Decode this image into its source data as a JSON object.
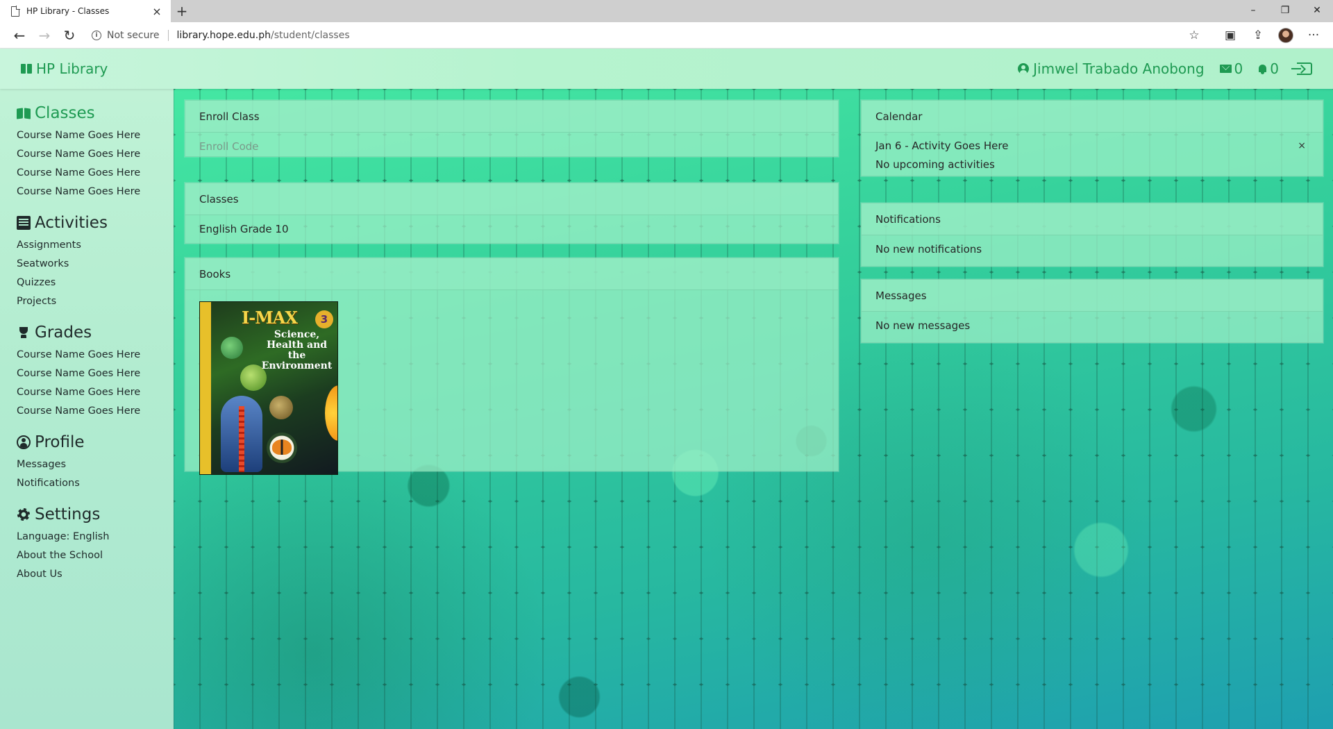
{
  "browser": {
    "tab_title": "HP Library - Classes",
    "tab_close": "×",
    "new_tab": "+",
    "security_label": "Not secure",
    "url_host": "library.hope.edu.ph",
    "url_path": "/student/classes",
    "window_controls": {
      "minimize": "–",
      "restore": "❐",
      "close": "✕"
    }
  },
  "navbar": {
    "brand": "HP Library",
    "user_name": "Jimwel Trabado Anobong",
    "message_count": "0",
    "notification_count": "0"
  },
  "sidebar": {
    "sections": [
      {
        "title": "Classes",
        "icon": "book-open-icon",
        "items": [
          "Course Name Goes Here",
          "Course Name Goes Here",
          "Course Name Goes Here",
          "Course Name Goes Here"
        ]
      },
      {
        "title": "Activities",
        "icon": "list-icon",
        "items": [
          "Assignments",
          "Seatworks",
          "Quizzes",
          "Projects"
        ]
      },
      {
        "title": "Grades",
        "icon": "trophy-icon",
        "items": [
          "Course Name Goes Here",
          "Course Name Goes Here",
          "Course Name Goes Here",
          "Course Name Goes Here"
        ]
      },
      {
        "title": "Profile",
        "icon": "user-circle-icon",
        "items": [
          "Messages",
          "Notifications"
        ]
      },
      {
        "title": "Settings",
        "icon": "gear-icon",
        "items": [
          "Language: English",
          "About the School",
          "About Us"
        ]
      }
    ]
  },
  "enroll": {
    "title": "Enroll Class",
    "placeholder": "Enroll Code",
    "value": ""
  },
  "classes": {
    "title": "Classes",
    "items": [
      "English Grade 10"
    ]
  },
  "books": {
    "title": "Books",
    "items": [
      {
        "cover_title": "I-MAX",
        "cover_subtitle": "Science, Health and the Environment",
        "cover_number": "3"
      }
    ]
  },
  "calendar": {
    "title": "Calendar",
    "event": "Jan 6 - Activity Goes Here",
    "close": "×",
    "empty_text": "No upcoming activities"
  },
  "notifications": {
    "title": "Notifications",
    "empty_text": "No new notifications"
  },
  "messages": {
    "title": "Messages",
    "empty_text": "No new messages"
  },
  "colors": {
    "brand_green": "#1e9a52",
    "nav_bg": "#b6f3cf",
    "card_bg": "#a0f0c8",
    "main_bg_top": "#45e7a3",
    "main_bg_bottom": "#1e9fb0"
  }
}
